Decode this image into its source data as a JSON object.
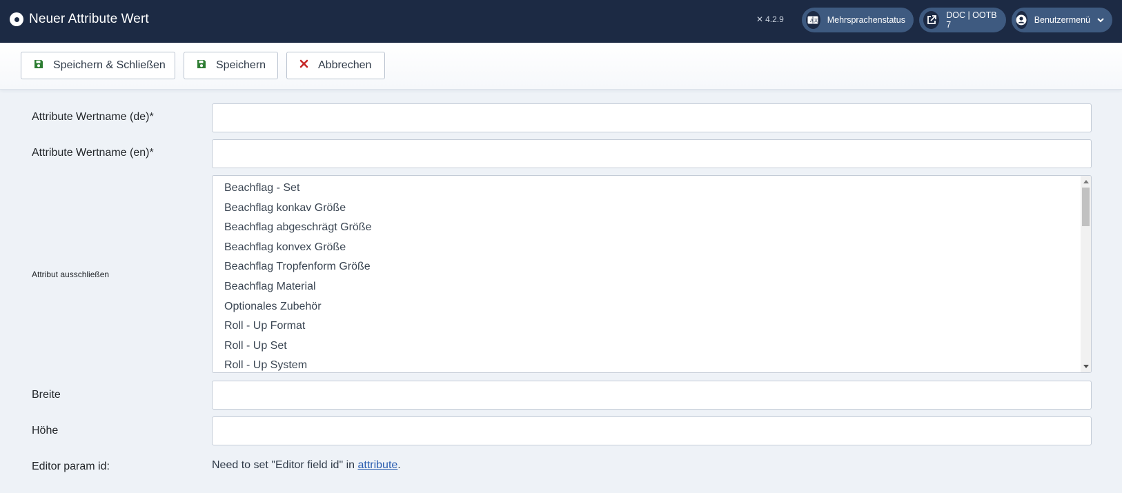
{
  "header": {
    "title": "Neuer Attribute Wert",
    "version": "4.2.9",
    "language_status": "Mehrsprachenstatus",
    "site_link": "DOC | OOTB 7",
    "user_menu": "Benutzermenü"
  },
  "toolbar": {
    "save_close_label": "Speichern & Schließen",
    "save_label": "Speichern",
    "cancel_label": "Abbrechen"
  },
  "form": {
    "name_de_label": "Attribute Wertname (de)*",
    "name_de_value": "",
    "name_en_label": "Attribute Wertname (en)*",
    "name_en_value": "",
    "exclude_label": "Attribut ausschließen",
    "exclude_options": [
      "Beachflag - Set",
      "Beachflag konkav Größe",
      "Beachflag abgeschrägt Größe",
      "Beachflag konvex Größe",
      "Beachflag Tropfenform Größe",
      "Beachflag Material",
      "Optionales Zubehör",
      "Roll - Up Format",
      "Roll - Up Set",
      "Roll - Up System"
    ],
    "width_label": "Breite",
    "width_value": "",
    "height_label": "Höhe",
    "height_value": "",
    "editor_label": "Editor param id:",
    "editor_note_prefix": "Need to set \"Editor field id\" in ",
    "editor_note_link": "attribute",
    "editor_note_suffix": "."
  },
  "colors": {
    "header_bg": "#1c2a44",
    "pill_bg": "#3e5a80",
    "save_icon": "#2e7d32",
    "cancel_icon": "#c62828",
    "link": "#2a5db0",
    "page_bg": "#eef2f7"
  },
  "icons": {
    "logo": "joomla-logo-icon",
    "save": "floppy-disk-icon",
    "cancel": "close-icon",
    "language": "translate-icon",
    "external": "external-link-icon",
    "user": "user-circle-icon",
    "dropdown": "chevron-down-icon"
  }
}
